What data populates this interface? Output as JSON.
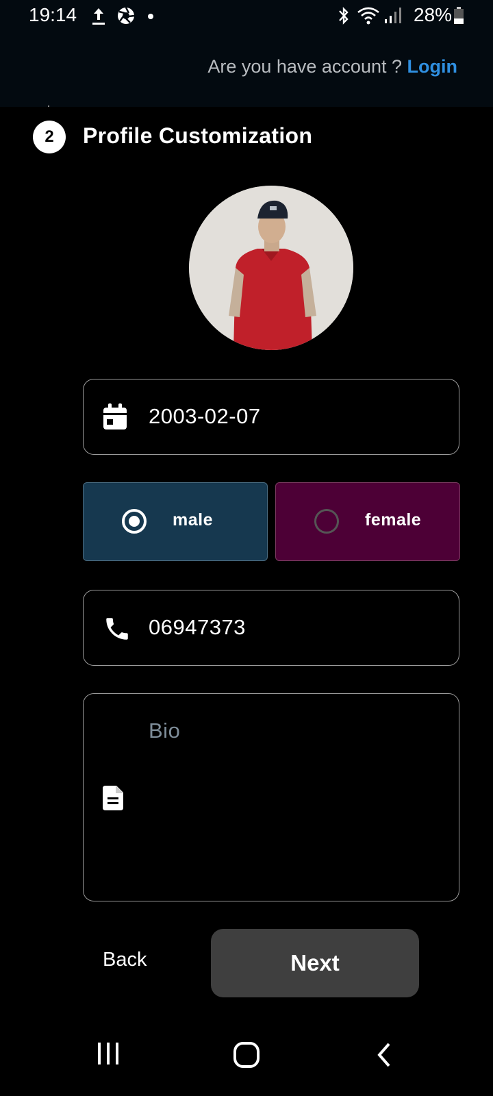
{
  "status_bar": {
    "time": "19:14",
    "battery_percent": "28%",
    "icons": [
      "upload-icon",
      "aperture-icon",
      "dot-icon",
      "bluetooth-icon",
      "wifi-icon",
      "signal-icon",
      "battery-icon"
    ]
  },
  "header": {
    "question": "Are you have account ?",
    "login_label": "Login"
  },
  "step": {
    "number": "2",
    "title": "Profile Customization"
  },
  "form": {
    "birthdate": "2003-02-07",
    "gender": {
      "selected": "male",
      "options": [
        {
          "label": "male",
          "selected": true
        },
        {
          "label": "female",
          "selected": false
        }
      ]
    },
    "phone": "06947373",
    "bio_placeholder": "Bio"
  },
  "actions": {
    "back_label": "Back",
    "next_label": "Next"
  },
  "colors": {
    "accent_link": "#2f8fe0",
    "male_bg": "#16384f",
    "female_bg": "#4d0036",
    "next_bg": "#3f3f3f"
  }
}
